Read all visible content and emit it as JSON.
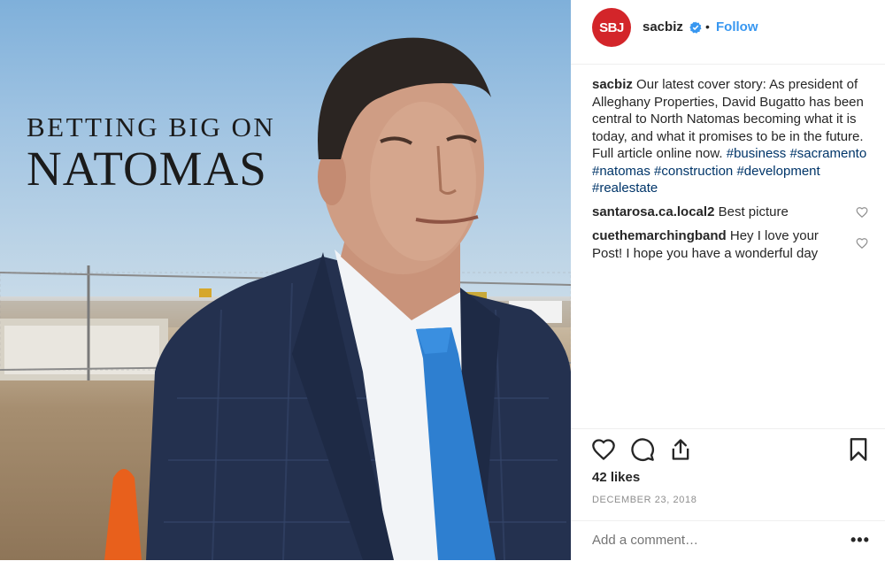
{
  "photo": {
    "cover_line1": "BETTING BIG ON",
    "cover_line2": "NATOMAS"
  },
  "header": {
    "avatar_text": "SBJ",
    "username": "sacbiz",
    "separator": "•",
    "follow_label": "Follow"
  },
  "caption": {
    "username": "sacbiz",
    "text": "Our latest cover story: As president of Alleghany Properties, David Bugatto has been central to North Natomas becoming what it is today, and what it promises to be in the future. Full article online now.",
    "hashtags": [
      "#business",
      "#sacramento",
      "#natomas",
      "#construction",
      "#development",
      "#realestate"
    ]
  },
  "comments": [
    {
      "username": "santarosa.ca.local2",
      "text": "Best picture"
    },
    {
      "username": "cuethemarchingband",
      "text": "Hey I love your Post! I hope you have a wonderful day"
    }
  ],
  "likes": "42 likes",
  "date": "DECEMBER 23, 2018",
  "comment_input": {
    "placeholder": "Add a comment…"
  },
  "more_label": "•••",
  "colors": {
    "brand_red": "#d3252a",
    "link_blue": "#3897f0",
    "hashtag": "#003569",
    "muted": "#8e8e8e"
  },
  "icons": [
    "verified-badge-icon",
    "heart-icon",
    "comment-icon",
    "share-icon",
    "bookmark-icon",
    "more-icon"
  ]
}
